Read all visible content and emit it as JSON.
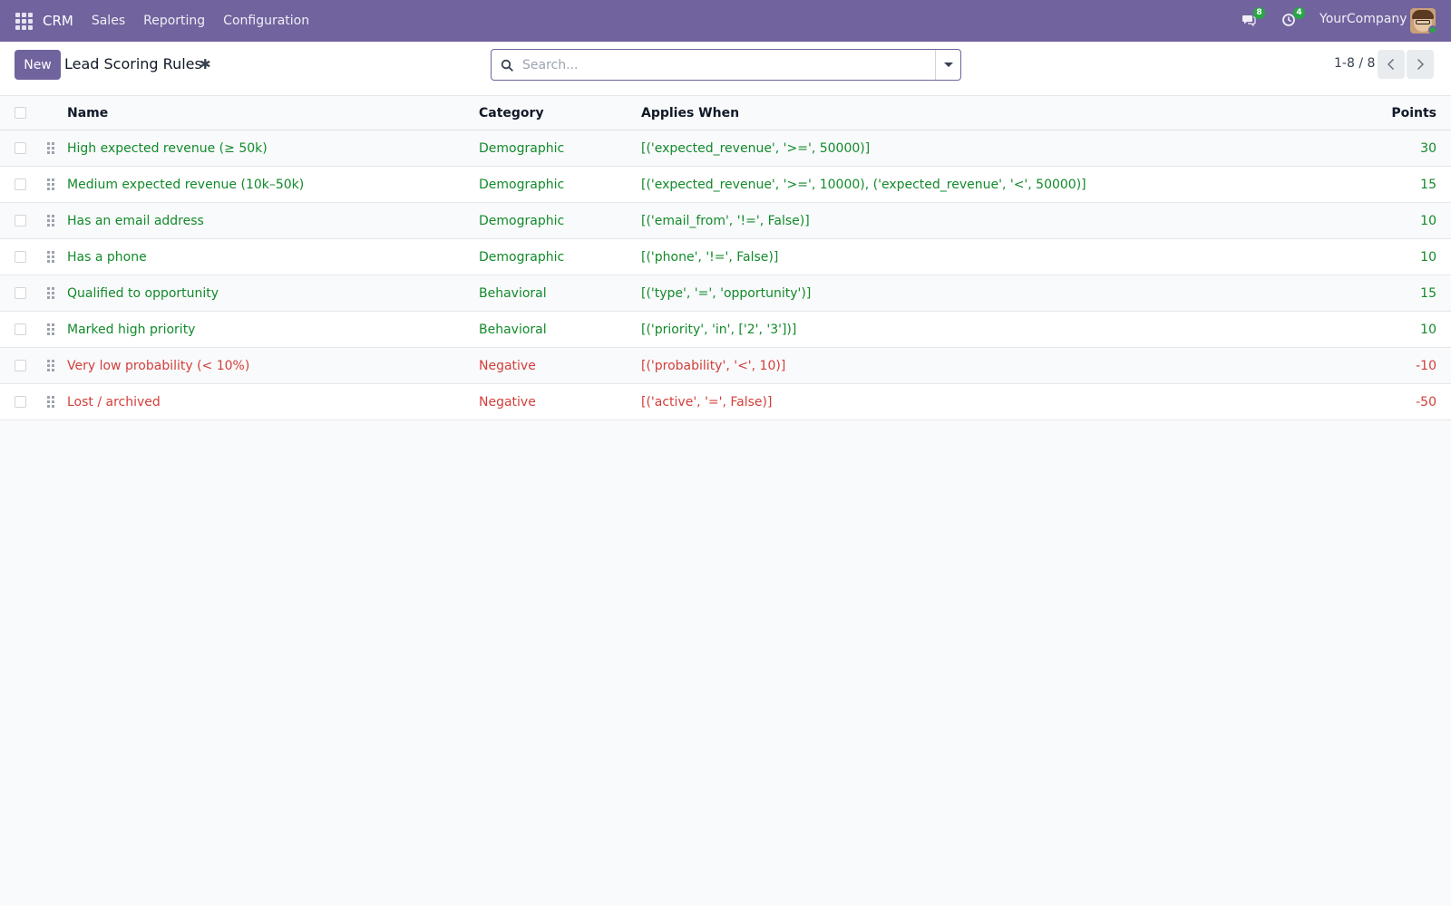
{
  "navbar": {
    "app_name": "CRM",
    "menu": [
      "Sales",
      "Reporting",
      "Configuration"
    ],
    "messages_count": "8",
    "activities_count": "4",
    "company": "YourCompany"
  },
  "control": {
    "new_label": "New",
    "title": "Lead Scoring Rules",
    "search_placeholder": "Search...",
    "pager": "1-8 / 8"
  },
  "table": {
    "headers": {
      "name": "Name",
      "category": "Category",
      "domain": "Applies When",
      "points": "Points"
    },
    "rows": [
      {
        "name": "High expected revenue (≥ 50k)",
        "category": "Demographic",
        "domain": "[('expected_revenue', '>=', 50000)]",
        "points": "30",
        "tone": "green"
      },
      {
        "name": "Medium expected revenue (10k–50k)",
        "category": "Demographic",
        "domain": "[('expected_revenue', '>=', 10000), ('expected_revenue', '<', 50000)]",
        "points": "15",
        "tone": "green"
      },
      {
        "name": "Has an email address",
        "category": "Demographic",
        "domain": "[('email_from', '!=', False)]",
        "points": "10",
        "tone": "green"
      },
      {
        "name": "Has a phone",
        "category": "Demographic",
        "domain": "[('phone', '!=', False)]",
        "points": "10",
        "tone": "green"
      },
      {
        "name": "Qualified to opportunity",
        "category": "Behavioral",
        "domain": "[('type', '=', 'opportunity')]",
        "points": "15",
        "tone": "green"
      },
      {
        "name": "Marked high priority",
        "category": "Behavioral",
        "domain": "[('priority', 'in', ['2', '3'])]",
        "points": "10",
        "tone": "green"
      },
      {
        "name": "Very low probability (< 10%)",
        "category": "Negative",
        "domain": "[('probability', '<', 10)]",
        "points": "-10",
        "tone": "red"
      },
      {
        "name": "Lost / archived",
        "category": "Negative",
        "domain": "[('active', '=', False)]",
        "points": "-50",
        "tone": "red"
      }
    ]
  },
  "colors": {
    "brand": "#71639e",
    "positive": "#128a2b",
    "negative": "#d23f3a",
    "badge": "#28a745"
  },
  "icons": [
    "apps-grid-icon",
    "chat-icon",
    "activity-clock-icon",
    "gear-icon",
    "search-icon",
    "caret-down-icon",
    "chevron-left-icon",
    "chevron-right-icon",
    "drag-handle-icon"
  ]
}
